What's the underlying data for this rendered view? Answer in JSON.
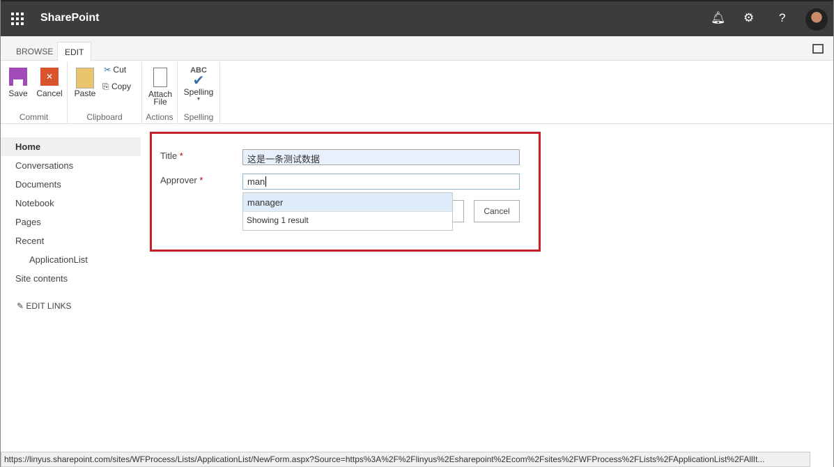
{
  "header": {
    "app_title": "SharePoint",
    "icons": [
      "app-launcher-icon",
      "bell-icon",
      "gear-icon",
      "help-icon",
      "avatar"
    ],
    "help_glyph": "?"
  },
  "tabs": [
    {
      "label": "BROWSE"
    },
    {
      "label": "EDIT"
    }
  ],
  "ribbon": {
    "commit": {
      "label": "Commit",
      "save": "Save",
      "cancel": "Cancel"
    },
    "clipboard": {
      "label": "Clipboard",
      "paste": "Paste",
      "cut": "Cut",
      "copy": "Copy"
    },
    "actions": {
      "label": "Actions",
      "attach1": "Attach",
      "attach2": "File"
    },
    "spelling": {
      "label": "Spelling",
      "abc": "ABC",
      "spelling": "Spelling"
    }
  },
  "nav": {
    "items": [
      "Home",
      "Conversations",
      "Documents",
      "Notebook",
      "Pages",
      "Recent",
      "ApplicationList",
      "Site contents"
    ],
    "edit_links": "EDIT LINKS"
  },
  "form": {
    "title_label": "Title",
    "approver_label": "Approver",
    "required": "*",
    "title_value": "这是一条测试数据",
    "approver_value": "man",
    "suggestion": "manager",
    "result_count": "Showing 1 result",
    "cancel": "Cancel"
  },
  "status_url": "https://linyus.sharepoint.com/sites/WFProcess/Lists/ApplicationList/NewForm.aspx?Source=https%3A%2F%2Flinyus%2Esharepoint%2Ecom%2Fsites%2FWFProcess%2FLists%2FApplicationList%2FAllIt..."
}
